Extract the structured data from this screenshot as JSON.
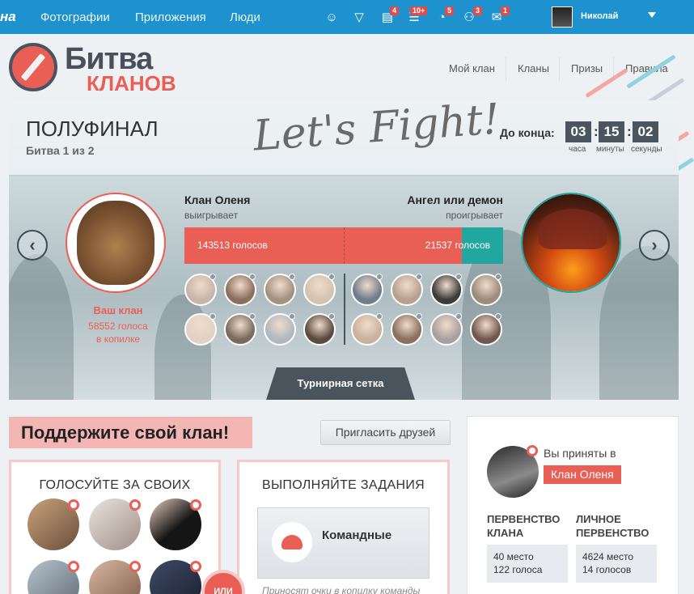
{
  "topbar": {
    "brand": "на",
    "nav": [
      "Фотографии",
      "Приложения",
      "Люди"
    ],
    "icons": [
      {
        "name": "smile-icon",
        "badge": ""
      },
      {
        "name": "diamond-icon",
        "badge": ""
      },
      {
        "name": "notes-icon",
        "badge": "4"
      },
      {
        "name": "list-icon",
        "badge": "10+"
      },
      {
        "name": "pie-icon",
        "badge": "5"
      },
      {
        "name": "friends-icon",
        "badge": "3"
      },
      {
        "name": "mail-icon",
        "badge": "1"
      }
    ],
    "user": "Николай"
  },
  "logo": {
    "line1": "Битва",
    "line2": "кланов"
  },
  "menu": [
    "Мой клан",
    "Кланы",
    "Призы",
    "Правила"
  ],
  "battle": {
    "stage": "ПОЛУФИНАЛ",
    "round": "Битва 1 из 2",
    "fight_text": "Let's Fight!",
    "until_label": "До конца:",
    "timer": {
      "hours": "03",
      "minutes": "15",
      "seconds": "02"
    },
    "timer_labels": {
      "hours": "часа",
      "minutes": "минуты",
      "seconds": "секунды"
    },
    "left": {
      "name": "Клан Оленя",
      "status": "выигрывает",
      "votes_label": "143513 голосов",
      "votes": 143513
    },
    "right": {
      "name": "Ангел или демон",
      "status": "проигрывает",
      "votes_label": "21537 голосов",
      "votes": 21537
    },
    "your_clan": "Ваш клан",
    "your_votes": "58552 голоса",
    "in_piggy": "в копилке",
    "bracket": "Турнирная сетка"
  },
  "support": {
    "title": "Поддержите свой клан!",
    "invite": "Пригласить друзей",
    "vote_title": "ГОЛОСУЙТЕ ЗА СВОИХ",
    "tasks_title": "ВЫПОЛНЯЙТЕ ЗАДАНИЯ",
    "or": "или",
    "team": "Командные",
    "team_hint": "Приносят очки в копилку команды"
  },
  "profile": {
    "accepted": "Вы приняты в",
    "clan": "Клан Оленя",
    "clan_title": "ПЕРВЕНСТВО КЛАНА",
    "clan_place": "40 место",
    "clan_votes": "122 голоса",
    "personal_title": "ЛИЧНОЕ ПЕРВЕНСТВО",
    "personal_place": "4624 место",
    "personal_votes": "14 голосов"
  },
  "colors": {
    "accent": "#e95f55",
    "teal": "#21a79f",
    "topbar": "#1e92cf",
    "dark": "#4a5560"
  }
}
